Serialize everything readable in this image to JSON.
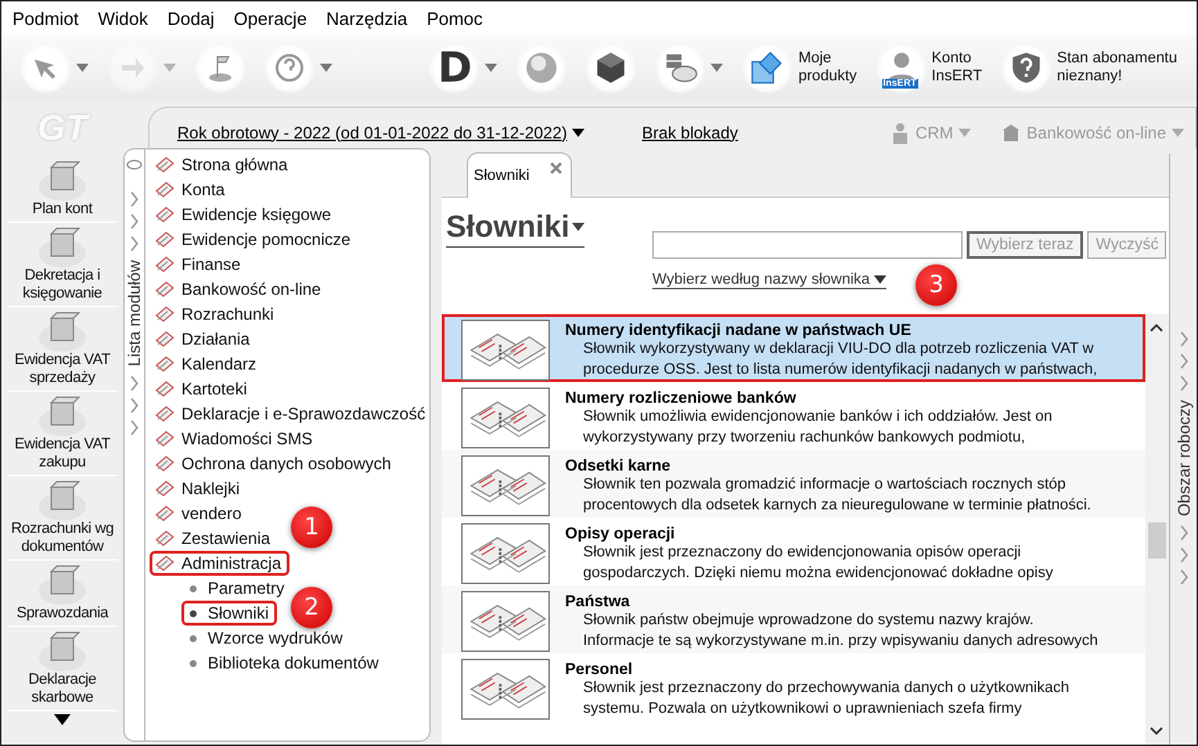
{
  "menu": [
    "Podmiot",
    "Widok",
    "Dodaj",
    "Operacje",
    "Narzędzia",
    "Pomoc"
  ],
  "tools_left": [
    {
      "dropdown": true,
      "disabled": false
    },
    {
      "dropdown": true,
      "disabled": true
    },
    {
      "dropdown": false,
      "disabled": false
    },
    {
      "dropdown": true,
      "disabled": false
    }
  ],
  "tools_right": [
    {
      "text": "D",
      "dropdown": true
    },
    {
      "dropdown": false
    },
    {
      "dropdown": false
    },
    {
      "dropdown": true
    },
    {
      "lines": [
        "Moje",
        "produkty"
      ],
      "dropdown": false
    },
    {
      "badge": "InsERT",
      "lines": [
        "Konto",
        "InsERT"
      ],
      "dropdown": false
    },
    {
      "lines": [
        "Stan abonamentu",
        "nieznany!"
      ],
      "dropdown": false
    }
  ],
  "logo": "GT",
  "header": {
    "fiscal_year": "Rok obrotowy - 2022  (od 01-01-2022 do 31-12-2022)",
    "lock": "Brak blokady",
    "crm": "CRM",
    "bank": "Bankowość on-line"
  },
  "shortcuts": [
    {
      "lines": [
        "Plan kont"
      ]
    },
    {
      "lines": [
        "Dekretacja i",
        "księgowanie"
      ]
    },
    {
      "lines": [
        "Ewidencja VAT",
        "sprzedaży"
      ]
    },
    {
      "lines": [
        "Ewidencja VAT",
        "zakupu"
      ]
    },
    {
      "lines": [
        "Rozrachunki wg",
        "dokumentów"
      ]
    },
    {
      "lines": [
        "Sprawozdania"
      ]
    },
    {
      "lines": [
        "Deklaracje",
        "skarbowe"
      ]
    }
  ],
  "module_strip": "Lista modułów",
  "modules": [
    {
      "label": "Strona główna"
    },
    {
      "label": "Konta"
    },
    {
      "label": "Ewidencje księgowe"
    },
    {
      "label": "Ewidencje pomocnicze"
    },
    {
      "label": "Finanse"
    },
    {
      "label": "Bankowość on-line"
    },
    {
      "label": "Rozrachunki"
    },
    {
      "label": "Działania"
    },
    {
      "label": "Kalendarz"
    },
    {
      "label": "Kartoteki"
    },
    {
      "label": "Deklaracje i e-Sprawozdawczość"
    },
    {
      "label": "Wiadomości SMS"
    },
    {
      "label": "Ochrona danych osobowych"
    },
    {
      "label": "Naklejki"
    },
    {
      "label": "vendero"
    },
    {
      "label": "Zestawienia"
    },
    {
      "label": "Administracja",
      "marked": true,
      "callout": "1",
      "children": [
        {
          "label": "Parametry",
          "selected": false,
          "marked": false
        },
        {
          "label": "Słowniki",
          "selected": true,
          "marked": true,
          "callout": "2"
        },
        {
          "label": "Wzorce wydruków",
          "selected": false,
          "marked": false
        },
        {
          "label": "Biblioteka dokumentów",
          "selected": false,
          "marked": false
        }
      ]
    }
  ],
  "tab": {
    "label": "Słowniki",
    "selected": true
  },
  "title": "Słowniki",
  "search": {
    "button": "Wybierz teraz",
    "clear": "Wyczyść"
  },
  "filter_link": "Wybierz według nazwy słownika",
  "dictionaries": [
    {
      "title": "Numery identyfikacji nadane w państwach UE",
      "lines": [
        "Słownik wykorzystywany w deklaracji VIU-DO dla potrzeb rozliczenia VAT w",
        "procedurze OSS. Jest to lista numerów identyfikacji nadanych w państwach,"
      ],
      "selected": true,
      "marked": true,
      "callout": "3"
    },
    {
      "title": "Numery rozliczeniowe banków",
      "lines": [
        "Słownik umożliwia ewidencjonowanie banków i ich oddziałów. Jest on",
        "wykorzystywany przy tworzeniu rachunków bankowych podmiotu,"
      ],
      "selected": false,
      "marked": false
    },
    {
      "title": "Odsetki karne",
      "lines": [
        "Słownik ten pozwala gromadzić informacje o wartościach rocznych stóp",
        "procentowych dla odsetek karnych za nieuregulowane w terminie płatności."
      ],
      "selected": false,
      "marked": false
    },
    {
      "title": "Opisy operacji",
      "lines": [
        "Słownik jest przeznaczony do ewidencjonowania opisów operacji",
        "gospodarczych. Dzięki niemu można ewidencjonować dokładne opisy"
      ],
      "selected": false,
      "marked": false
    },
    {
      "title": "Państwa",
      "lines": [
        "Słownik państw obejmuje wprowadzone do systemu nazwy krajów.",
        "Informacje te są wykorzystywane m.in. przy wpisywaniu danych adresowych"
      ],
      "selected": false,
      "marked": false
    },
    {
      "title": "Personel",
      "lines": [
        "Słownik jest przeznaczony do przechowywania danych o użytkownikach",
        "systemu. Pozwala on użytkownikowi o uprawnieniach szefa firmy"
      ],
      "selected": false,
      "marked": false
    }
  ],
  "work_strip": "Obszar roboczy"
}
